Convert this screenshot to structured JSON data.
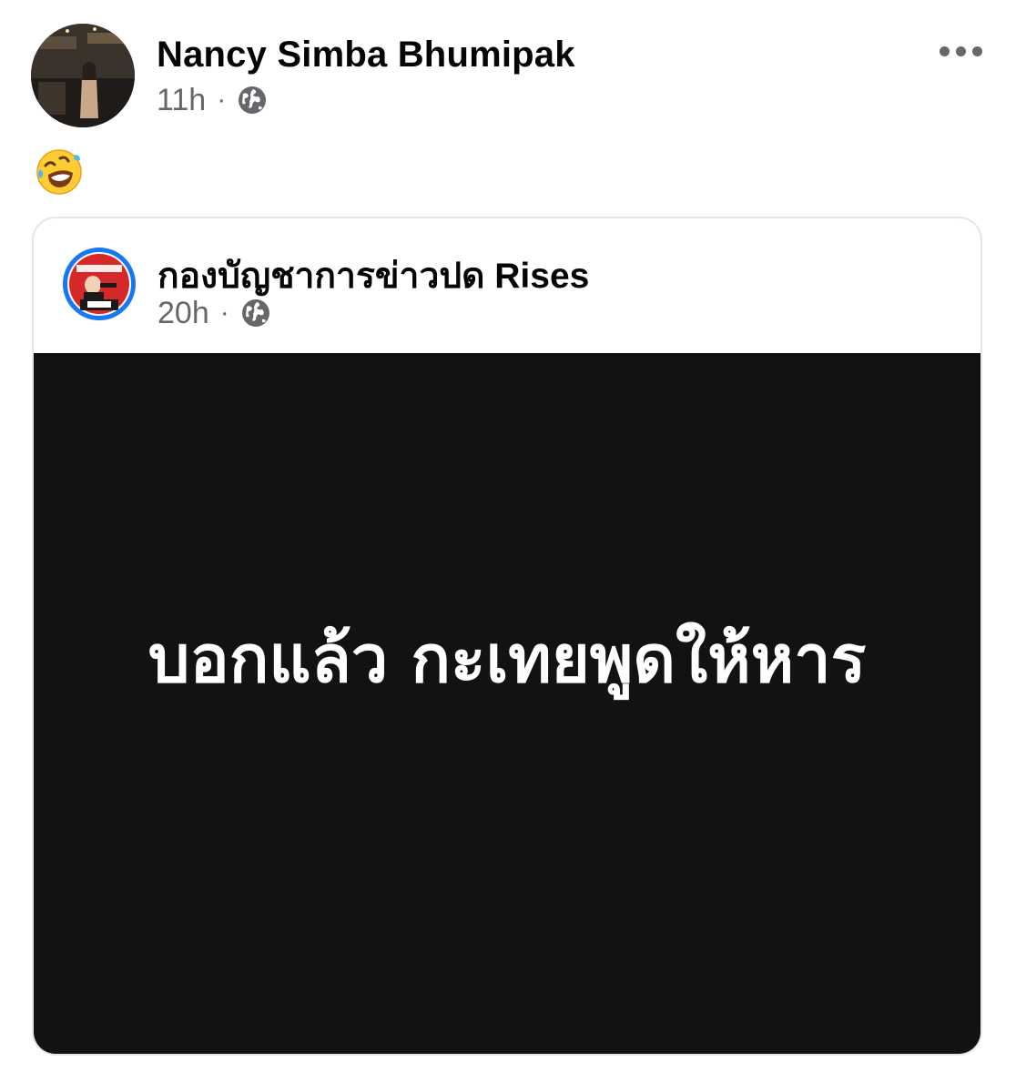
{
  "post": {
    "author_name": "Nancy Simba Bhumipak",
    "time": "11h",
    "separator": "·",
    "audience_icon": "globe-icon",
    "more_icon": "more-options-icon",
    "message_emoji": "rolling-on-the-floor-laughing-emoji"
  },
  "shared_post": {
    "page_name": "กองบัญชาการข่าวปด Rises",
    "time": "20h",
    "separator": "·",
    "audience_icon": "globe-icon",
    "image_text": "บอกแล้ว กะเทยพูดให้หาร",
    "image_background": "#121212",
    "avatar_ring_color": "#1877f2"
  },
  "colors": {
    "name_text": "#050505",
    "meta_text": "#65676b",
    "card_border": "#e4e6eb"
  }
}
